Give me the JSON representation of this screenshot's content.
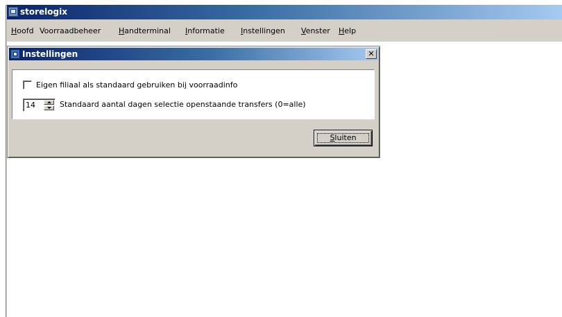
{
  "app": {
    "title": "storelogix",
    "icon": "app-window-icon"
  },
  "menubar": {
    "items": [
      {
        "mnemonic": "H",
        "rest": "oofd"
      },
      {
        "mnemonic": "",
        "rest": "Voorraadbeheer"
      },
      {
        "mnemonic": "H",
        "rest": "andterminal"
      },
      {
        "mnemonic": "I",
        "rest": "nformatie"
      },
      {
        "mnemonic": "I",
        "rest": "nstellingen"
      },
      {
        "mnemonic": "V",
        "rest": "enster"
      },
      {
        "mnemonic": "H",
        "rest": "elp"
      }
    ]
  },
  "dialog": {
    "title": "Instellingen",
    "close_glyph": "✕",
    "option_checkbox": {
      "checked": false,
      "label": "Eigen filiaal als standaard gebruiken bij voorraadinfo"
    },
    "days_spinner": {
      "value": "14",
      "label": "Standaard aantal dagen selectie openstaande transfers (0=alle)"
    },
    "close_button": {
      "mnemonic": "S",
      "rest": "luiten"
    }
  },
  "colors": {
    "titlebar_start": "#0a246a",
    "titlebar_end": "#a6caf0",
    "face": "#d4d0c8"
  }
}
